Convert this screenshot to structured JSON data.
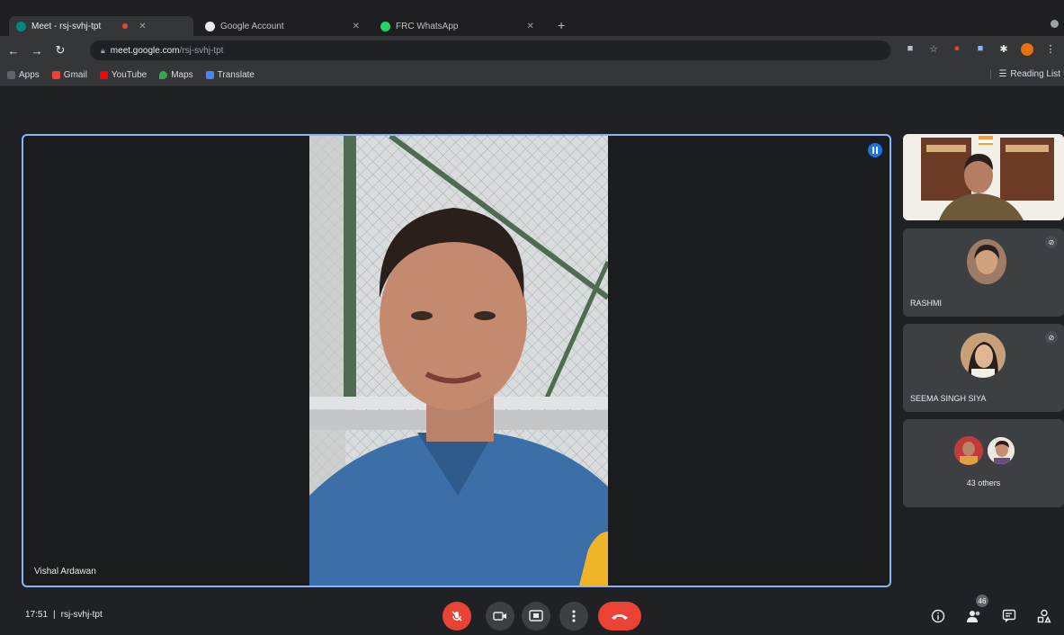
{
  "browser": {
    "tabs": [
      {
        "title": "Meet - rsj-svhj-tpt",
        "active": true
      },
      {
        "title": "Google Account",
        "active": false
      },
      {
        "title": "FRC WhatsApp",
        "active": false
      }
    ],
    "new_tab": "+",
    "url": {
      "host": "meet.google.com",
      "path": "/rsj-svhj-tpt"
    },
    "bookmarks": [
      "Apps",
      "Gmail",
      "YouTube",
      "Maps",
      "Translate"
    ],
    "reading_list": "Reading List"
  },
  "meet": {
    "presenter": {
      "name": "Vishal Ardawan"
    },
    "participants": [
      {
        "name": ""
      },
      {
        "name": "RASHMI",
        "muted": true
      },
      {
        "name": "SEEMA SINGH SIYA",
        "muted": true
      }
    ],
    "others": "43 others",
    "participant_count": "46",
    "time": "17:51",
    "separator": "|",
    "meeting_code": "rsj-svhj-tpt"
  },
  "colors": {
    "accent": "#8ab4f8",
    "danger": "#ea4335",
    "surface": "#3c4043",
    "background": "#202124"
  }
}
